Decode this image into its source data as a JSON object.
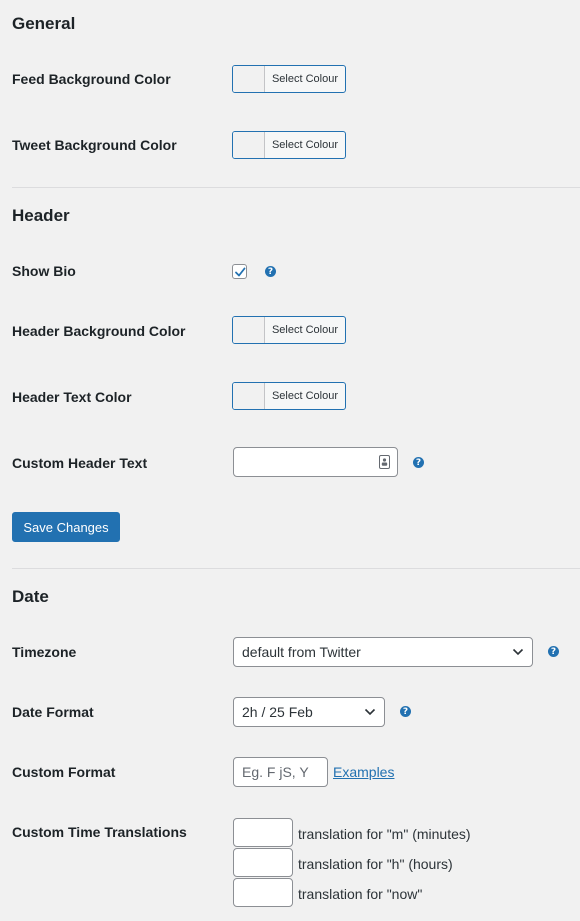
{
  "general": {
    "title": "General",
    "feed_bg_label": "Feed Background Color",
    "tweet_bg_label": "Tweet Background Color",
    "select_colour": "Select Colour"
  },
  "header": {
    "title": "Header",
    "show_bio_label": "Show Bio",
    "show_bio_checked": true,
    "header_bg_label": "Header Background Color",
    "header_text_label": "Header Text Color",
    "custom_header_label": "Custom Header Text",
    "custom_header_value": ""
  },
  "save_button": "Save Changes",
  "date": {
    "title": "Date",
    "timezone_label": "Timezone",
    "timezone_value": "default from Twitter",
    "date_format_label": "Date Format",
    "date_format_value": "2h / 25 Feb",
    "custom_format_label": "Custom Format",
    "custom_format_placeholder": "Eg. F jS, Y",
    "examples_link": "Examples",
    "translations_label": "Custom Time Translations",
    "translations": [
      {
        "label": "translation for \"m\" (minutes)"
      },
      {
        "label": "translation for \"h\" (hours)"
      },
      {
        "label": "translation for \"now\""
      }
    ]
  },
  "help_glyph": "?",
  "icons": [
    "help-icon",
    "checkmark-icon",
    "chevron-down-icon",
    "contact-card-icon"
  ],
  "colors": {
    "accent": "#2271b1",
    "background": "#f1f1f1"
  }
}
